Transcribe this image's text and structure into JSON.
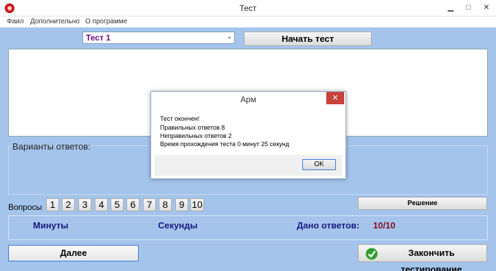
{
  "window": {
    "title": "Тест",
    "controls": {
      "minimize": "▁",
      "maximize": "□",
      "close": "✕"
    }
  },
  "menu": {
    "items": [
      "Фаил",
      "Дополнительно",
      "О программе"
    ]
  },
  "test_select": {
    "value": "Тест 1"
  },
  "start_button": {
    "label": "Начать тест"
  },
  "answers": {
    "label": "Варианты ответов:"
  },
  "questions": {
    "label": "Вопросы",
    "buttons": [
      "1",
      "2",
      "3",
      "4",
      "5",
      "6",
      "7",
      "8",
      "9",
      "10"
    ]
  },
  "solution_button": {
    "label": "Решение"
  },
  "stats": {
    "minutes_label": "Минуты",
    "seconds_label": "Секунды",
    "answered_label": "Дано ответов:",
    "answered_value": "10/10"
  },
  "next_button": {
    "label": "Далее"
  },
  "finish_button": {
    "label": "Закончить тестирование"
  },
  "dialog": {
    "title": "Арм",
    "lines": [
      "Тест окончен!",
      "Правильных ответов 8",
      "Неправильных ответов 2",
      "Время прохождения теста  0 минут 25 секунд"
    ],
    "ok_label": "OK",
    "close_glyph": "✕"
  },
  "colors": {
    "accent": "#a4c4ec",
    "count": "#8a0f2a",
    "stats_text": "#1a1a80"
  }
}
